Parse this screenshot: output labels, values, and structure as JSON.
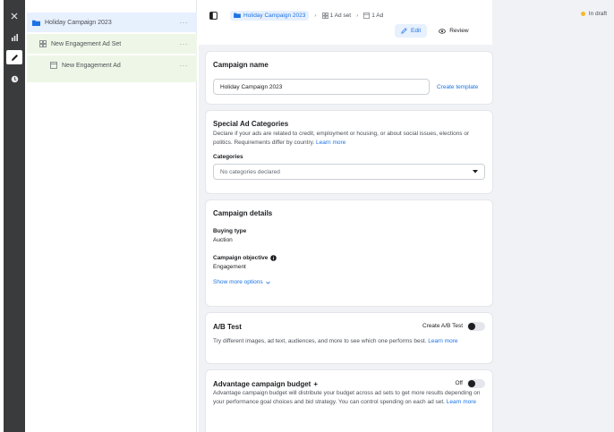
{
  "rail": {
    "items": [
      {
        "name": "close-icon"
      },
      {
        "name": "chart-icon"
      },
      {
        "name": "pencil-icon"
      },
      {
        "name": "clock-icon"
      }
    ]
  },
  "tree": {
    "campaign": "Holiday Campaign 2023",
    "adset": "New Engagement Ad Set",
    "ad": "New Engagement Ad",
    "more": "···"
  },
  "topbar": {
    "crumb_campaign": "Holiday Campaign 2023",
    "crumb_adset": "1 Ad set",
    "crumb_ad": "1 Ad",
    "status": "In draft",
    "edit_label": "Edit",
    "review_label": "Review",
    "colors": {
      "accent": "#1b74e4",
      "draft": "#f7b928"
    }
  },
  "campaign_name": {
    "title": "Campaign name",
    "value": "Holiday Campaign 2023",
    "create_template": "Create template"
  },
  "special": {
    "title": "Special Ad Categories",
    "text": "Declare if your ads are related to credit, employment or housing, or about social issues, elections or politics. Requirements differ by country.",
    "learn_more": "Learn more",
    "categories_label": "Categories",
    "categories_value": "No categories declared"
  },
  "details": {
    "title": "Campaign details",
    "buying_type_label": "Buying type",
    "buying_type_value": "Auction",
    "objective_label": "Campaign objective",
    "objective_value": "Engagement",
    "show_more": "Show more options"
  },
  "abtest": {
    "title": "A/B Test",
    "toggle_label": "Create A/B Test",
    "text": "Try different images, ad text, audiences, and more to see which one performs best.",
    "learn_more": "Learn more"
  },
  "budget": {
    "title": "Advantage campaign budget",
    "toggle_label": "Off",
    "text": "Advantage campaign budget will distribute your budget across ad sets to get more results depending on your performance goal choices and bid strategy. You can control spending on each ad set.",
    "learn_more": "Learn more"
  }
}
